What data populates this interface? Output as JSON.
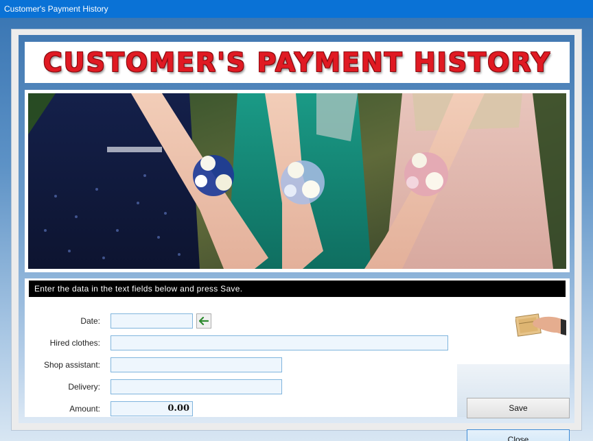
{
  "window": {
    "title": "Customer's Payment History"
  },
  "header": {
    "banner_title": "CUSTOMER'S PAYMENT HISTORY"
  },
  "form": {
    "instruction": "Enter the data in the text fields below and press Save.",
    "fields": [
      {
        "label": "Date:",
        "value": "",
        "placeholder": ""
      },
      {
        "label": "Hired clothes:",
        "value": "",
        "placeholder": ""
      },
      {
        "label": "Shop assistant:",
        "value": "",
        "placeholder": ""
      },
      {
        "label": "Delivery:",
        "value": "",
        "placeholder": ""
      },
      {
        "label": "Amount:",
        "value": "0.00",
        "placeholder": ""
      }
    ],
    "date_picker_icon": "arrow-left-icon"
  },
  "buttons": {
    "save_label": "Save",
    "close_label": "Close"
  },
  "colors": {
    "titlebar": "#0a72d6",
    "banner_text": "#e01a23",
    "input_background": "#eef6fd",
    "input_border": "#7fb4dd",
    "close_button_border": "#3c8ad6"
  }
}
